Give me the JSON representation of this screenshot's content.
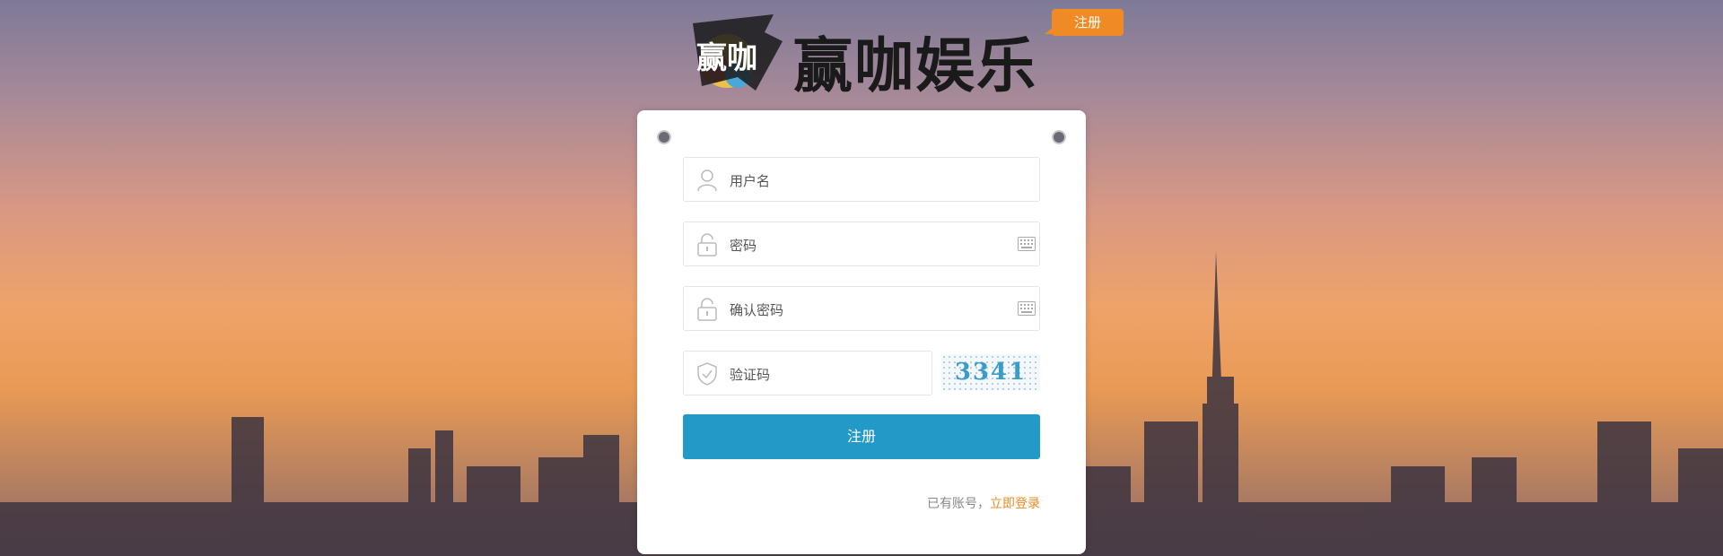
{
  "header": {
    "logo_text": "赢咖娱乐",
    "logo_mark_text": "赢咖",
    "tag_label": "注册"
  },
  "form": {
    "username_placeholder": "用户名",
    "password_placeholder": "密码",
    "confirm_placeholder": "确认密码",
    "captcha_placeholder": "验证码",
    "captcha_code": "3341",
    "submit_label": "注册"
  },
  "footer": {
    "prompt": "已有账号，",
    "login_link": "立即登录"
  },
  "colors": {
    "accent_orange": "#f08a24",
    "primary_blue": "#2399c7"
  },
  "icons": [
    "user-icon",
    "lock-icon",
    "keyboard-icon",
    "shield-check-icon"
  ]
}
